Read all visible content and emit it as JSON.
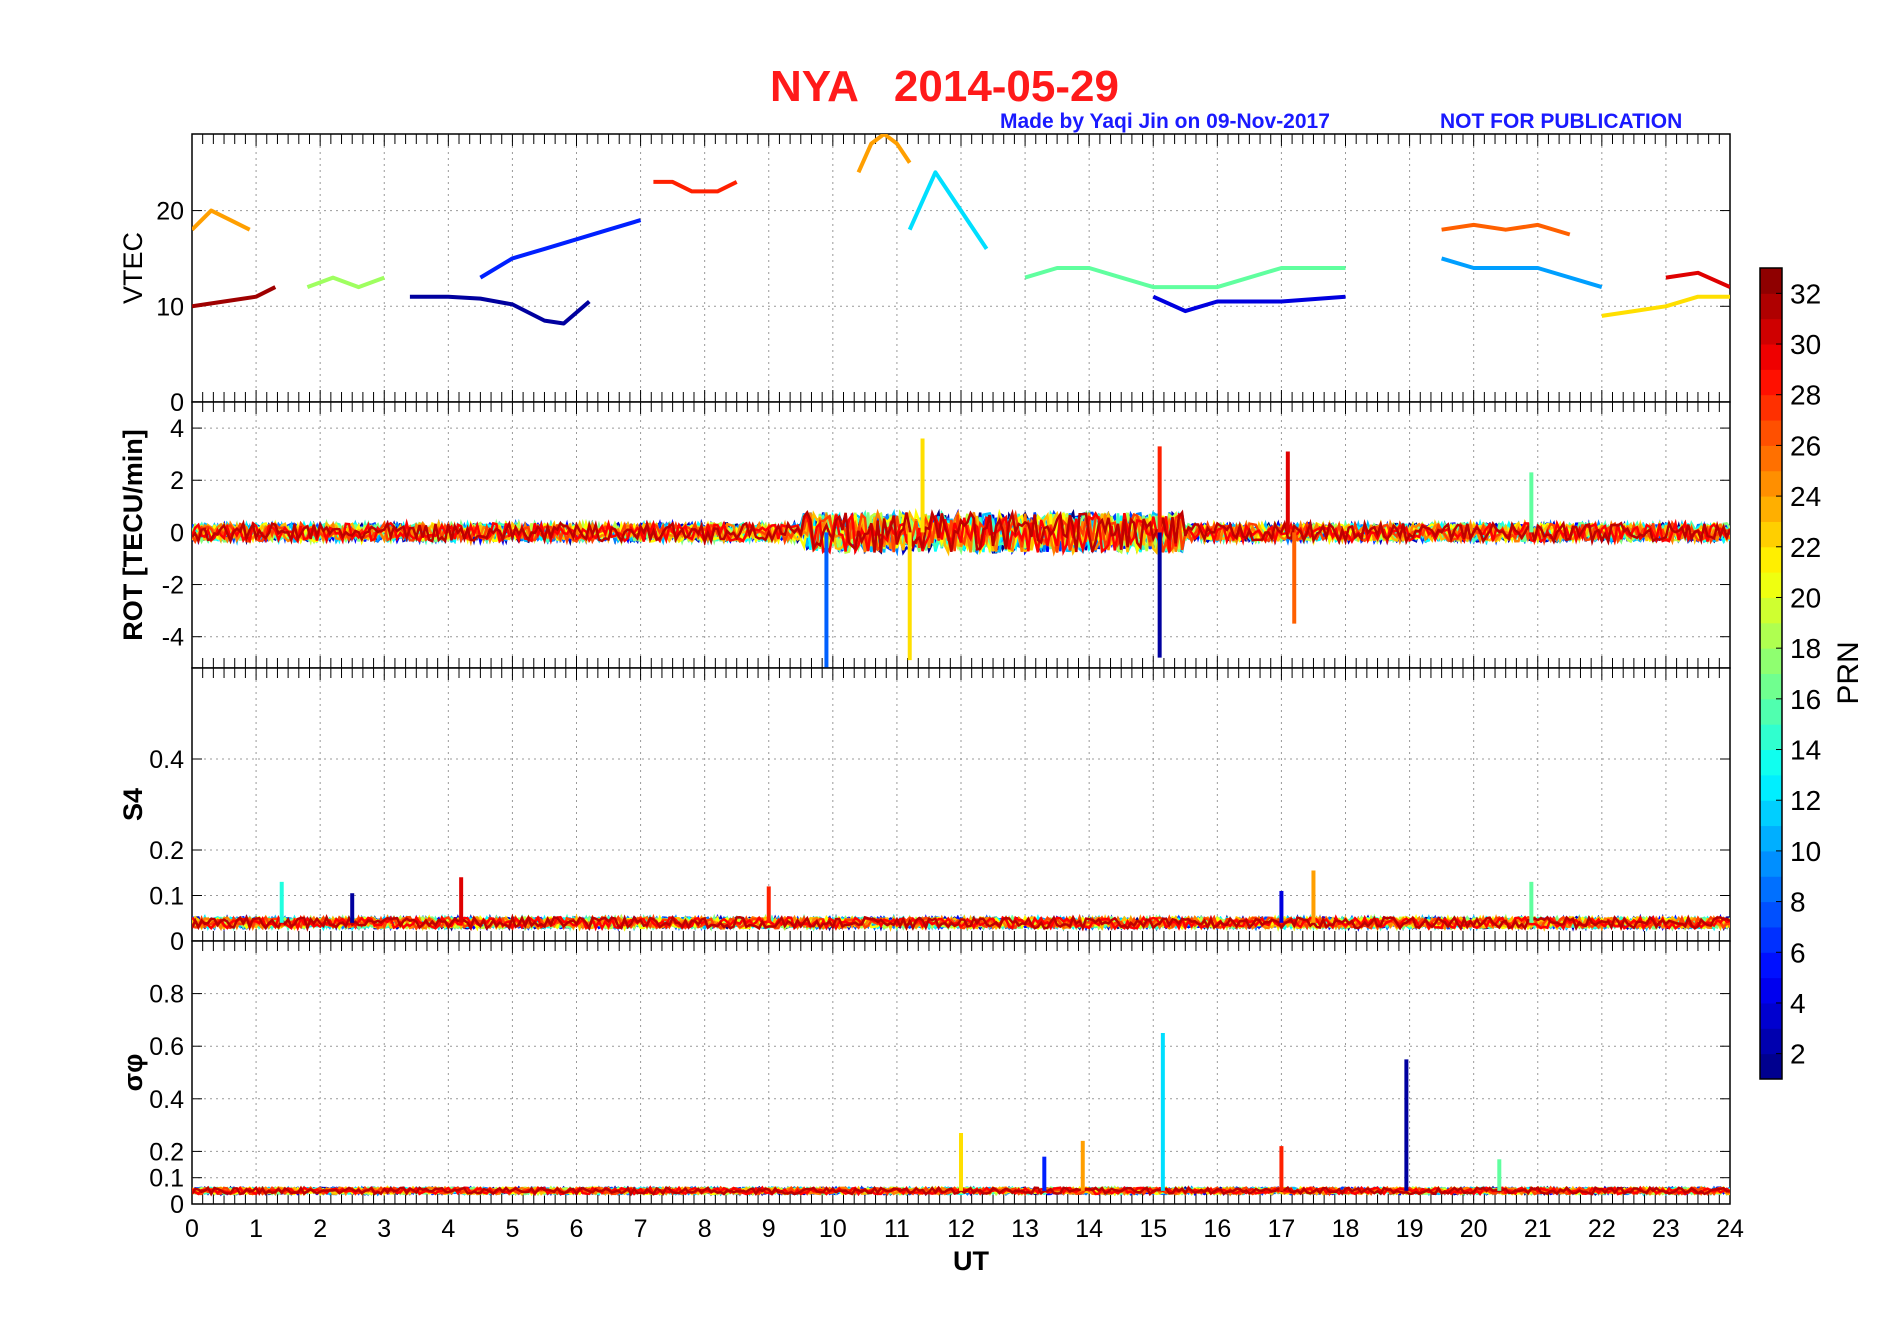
{
  "header": {
    "title": "NYA   2014-05-29",
    "credit": "Made by Yaqi Jin on 09-Nov-2017",
    "notice": "NOT FOR PUBLICATION"
  },
  "colors": {
    "title": "#ff1a1a",
    "annotation": "#1a1aff",
    "colormap": "jet"
  },
  "chart_data": [
    {
      "type": "line",
      "panel": "vtec",
      "ylabel": "VTEC",
      "ylim": [
        0,
        28
      ],
      "yticks": [
        0,
        10,
        20
      ],
      "xlim": [
        0,
        24
      ],
      "grid": true,
      "notes": "Many PRN tracks, mostly 10-20 TECU, peaking near 27-28 around 10.5-11 UT",
      "series": [
        {
          "name": "2",
          "x": [
            3.4,
            4,
            4.5,
            5,
            5.5,
            5.8,
            6.2
          ],
          "y": [
            11,
            11,
            10.8,
            10.2,
            8.5,
            8.2,
            10.5
          ]
        },
        {
          "name": "6",
          "x": [
            4.5,
            5,
            5.5,
            6,
            6.5,
            7
          ],
          "y": [
            13,
            15,
            16,
            17,
            18,
            19
          ]
        },
        {
          "name": "24",
          "x": [
            0,
            0.3,
            0.6,
            0.9
          ],
          "y": [
            18,
            20,
            19,
            18
          ]
        },
        {
          "name": "24b",
          "x": [
            10.4,
            10.6,
            10.8,
            11,
            11.2
          ],
          "y": [
            24,
            27,
            28,
            27,
            25
          ]
        },
        {
          "name": "12",
          "x": [
            11.2,
            11.6,
            12,
            12.4
          ],
          "y": [
            18,
            24,
            20,
            16
          ]
        },
        {
          "name": "28",
          "x": [
            7.2,
            7.5,
            7.8,
            8.2,
            8.5
          ],
          "y": [
            23,
            23,
            22,
            22,
            23
          ]
        },
        {
          "name": "26",
          "x": [
            19.5,
            20,
            20.5,
            21,
            21.5
          ],
          "y": [
            18,
            18.5,
            18,
            18.5,
            17.5
          ]
        },
        {
          "name": "32",
          "x": [
            0,
            0.5,
            1,
            1.3
          ],
          "y": [
            10,
            10.5,
            11,
            12
          ]
        },
        {
          "name": "4",
          "x": [
            15,
            15.5,
            16,
            17,
            18
          ],
          "y": [
            11,
            9.5,
            10.5,
            10.5,
            11
          ]
        },
        {
          "name": "10",
          "x": [
            19.5,
            20,
            21,
            22
          ],
          "y": [
            15,
            14,
            14,
            12
          ]
        },
        {
          "name": "22",
          "x": [
            22,
            22.5,
            23,
            23.5,
            24
          ],
          "y": [
            9,
            9.5,
            10,
            11,
            11
          ]
        },
        {
          "name": "30",
          "x": [
            23,
            23.5,
            24
          ],
          "y": [
            13,
            13.5,
            12
          ]
        },
        {
          "name": "18",
          "x": [
            1.8,
            2.2,
            2.6,
            3
          ],
          "y": [
            12,
            13,
            12,
            13
          ]
        },
        {
          "name": "16",
          "x": [
            13,
            13.5,
            14,
            14.5,
            15,
            16,
            17,
            18
          ],
          "y": [
            13,
            14,
            14,
            13,
            12,
            12,
            14,
            14
          ]
        }
      ]
    },
    {
      "type": "line",
      "panel": "rot",
      "ylabel": "ROT [TECU/min]",
      "ylim": [
        -5.2,
        5
      ],
      "yticks": [
        -4,
        -2,
        0,
        2,
        4
      ],
      "xlim": [
        0,
        24
      ],
      "grid": true,
      "notes": "Fluctuations around 0; extremes near 10-12 UT and 15 UT",
      "spikes": [
        {
          "prn": 8,
          "x": 9.9,
          "y": -5.2
        },
        {
          "prn": 22,
          "x": 11.2,
          "y": -4.9
        },
        {
          "prn": 2,
          "x": 15.1,
          "y": -4.8
        },
        {
          "prn": 22,
          "x": 11.4,
          "y": 3.6
        },
        {
          "prn": 28,
          "x": 15.1,
          "y": 3.3
        },
        {
          "prn": 30,
          "x": 17.1,
          "y": 3.1
        },
        {
          "prn": 16,
          "x": 20.9,
          "y": 2.3
        },
        {
          "prn": 26,
          "x": 17.2,
          "y": -3.5
        }
      ]
    },
    {
      "type": "line",
      "panel": "s4",
      "ylabel": "S4",
      "ylim": [
        0,
        0.6
      ],
      "yticks": [
        0,
        0.1,
        0.2,
        0.4
      ],
      "xlim": [
        0,
        24
      ],
      "grid": true,
      "notes": "Baseline ~0.03-0.05 with peaks to ~0.15",
      "spikes": [
        {
          "prn": 30,
          "x": 4.2,
          "y": 0.14
        },
        {
          "prn": 24,
          "x": 17.5,
          "y": 0.155
        },
        {
          "prn": 14,
          "x": 1.4,
          "y": 0.13
        },
        {
          "prn": 16,
          "x": 20.9,
          "y": 0.13
        },
        {
          "prn": 28,
          "x": 9,
          "y": 0.12
        },
        {
          "prn": 4,
          "x": 17,
          "y": 0.11
        },
        {
          "prn": 2,
          "x": 2.5,
          "y": 0.105
        }
      ]
    },
    {
      "type": "line",
      "panel": "sigma_phi",
      "ylabel": "σφ",
      "ylim": [
        0,
        1
      ],
      "yticks": [
        0,
        0.1,
        0.2,
        0.4,
        0.6,
        0.8
      ],
      "xlim": [
        0,
        24
      ],
      "xticks": [
        0,
        1,
        2,
        3,
        4,
        5,
        6,
        7,
        8,
        9,
        10,
        11,
        12,
        13,
        14,
        15,
        16,
        17,
        18,
        19,
        20,
        21,
        22,
        23,
        24
      ],
      "xlabel": "UT",
      "grid": true,
      "notes": "Baseline ~0.05 with bursts 0.1-0.25 from 9-14 UT",
      "spikes": [
        {
          "prn": 12,
          "x": 15.15,
          "y": 0.65
        },
        {
          "prn": 2,
          "x": 18.95,
          "y": 0.55
        },
        {
          "prn": 22,
          "x": 12,
          "y": 0.27
        },
        {
          "prn": 24,
          "x": 13.9,
          "y": 0.24
        },
        {
          "prn": 28,
          "x": 17,
          "y": 0.22
        },
        {
          "prn": 16,
          "x": 20.4,
          "y": 0.17
        },
        {
          "prn": 6,
          "x": 13.3,
          "y": 0.18
        }
      ]
    }
  ],
  "colorbar": {
    "label": "PRN",
    "min": 1,
    "max": 33,
    "ticks": [
      2,
      4,
      6,
      8,
      10,
      12,
      14,
      16,
      18,
      20,
      22,
      24,
      26,
      28,
      30,
      32
    ]
  }
}
